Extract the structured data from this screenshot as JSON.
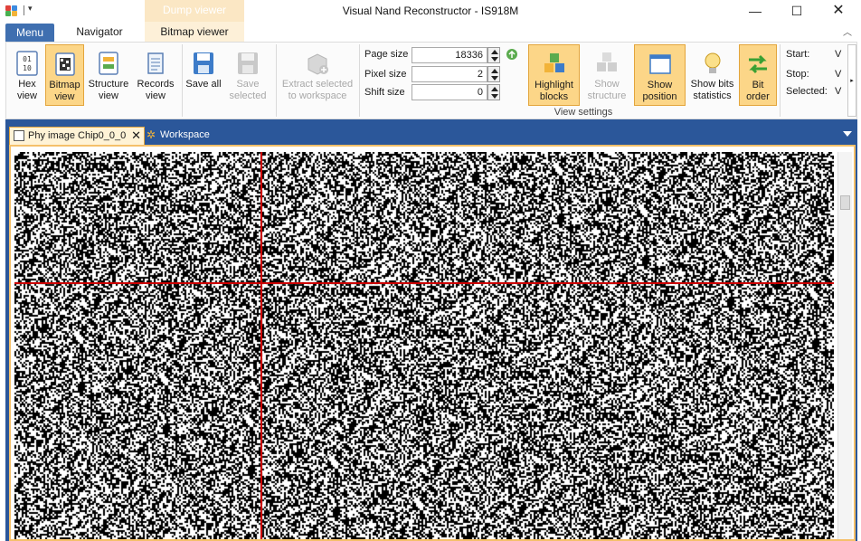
{
  "titlebar": {
    "window_title": "Visual Nand Reconstructor - IS918M",
    "context_tab": "Dump viewer",
    "qat_dropdown": "▾",
    "minimize": "—",
    "maximize": "☐",
    "close": "✕"
  },
  "ribbon_tabs": {
    "menu": "Menu",
    "navigator": "Navigator",
    "bitmap_viewer": "Bitmap viewer",
    "collapse": "︿"
  },
  "ribbon": {
    "hex_view": "Hex view",
    "bitmap_view": "Bitmap view",
    "structure_view": "Structure view",
    "records_view": "Records view",
    "save_all": "Save all",
    "save_selected": "Save selected",
    "extract_selected": "Extract selected to workspace",
    "page_size_label": "Page size",
    "page_size_value": "18336",
    "pixel_size_label": "Pixel size",
    "pixel_size_value": "2",
    "shift_size_label": "Shift size",
    "shift_size_value": "0",
    "highlight_blocks": "Highlight blocks",
    "show_structure": "Show structure",
    "show_position": "Show position",
    "show_bits_statistics": "Show bits statistics",
    "bit_order": "Bit order",
    "group_label": "View settings",
    "start_label": "Start:",
    "start_value": "V",
    "stop_label": "Stop:",
    "stop_value": "V",
    "selected_label": "Selected:",
    "selected_value": "V",
    "scroll_arrow": "▸"
  },
  "document_tabs": {
    "phy_image": "Phy image Chip0_0_0",
    "close": "✕",
    "workspace": "Workspace",
    "gear": "✲"
  },
  "colors": {
    "accent_blue": "#2b579a",
    "active_orange": "#fcd688",
    "crosshair_red": "#cc0000"
  }
}
